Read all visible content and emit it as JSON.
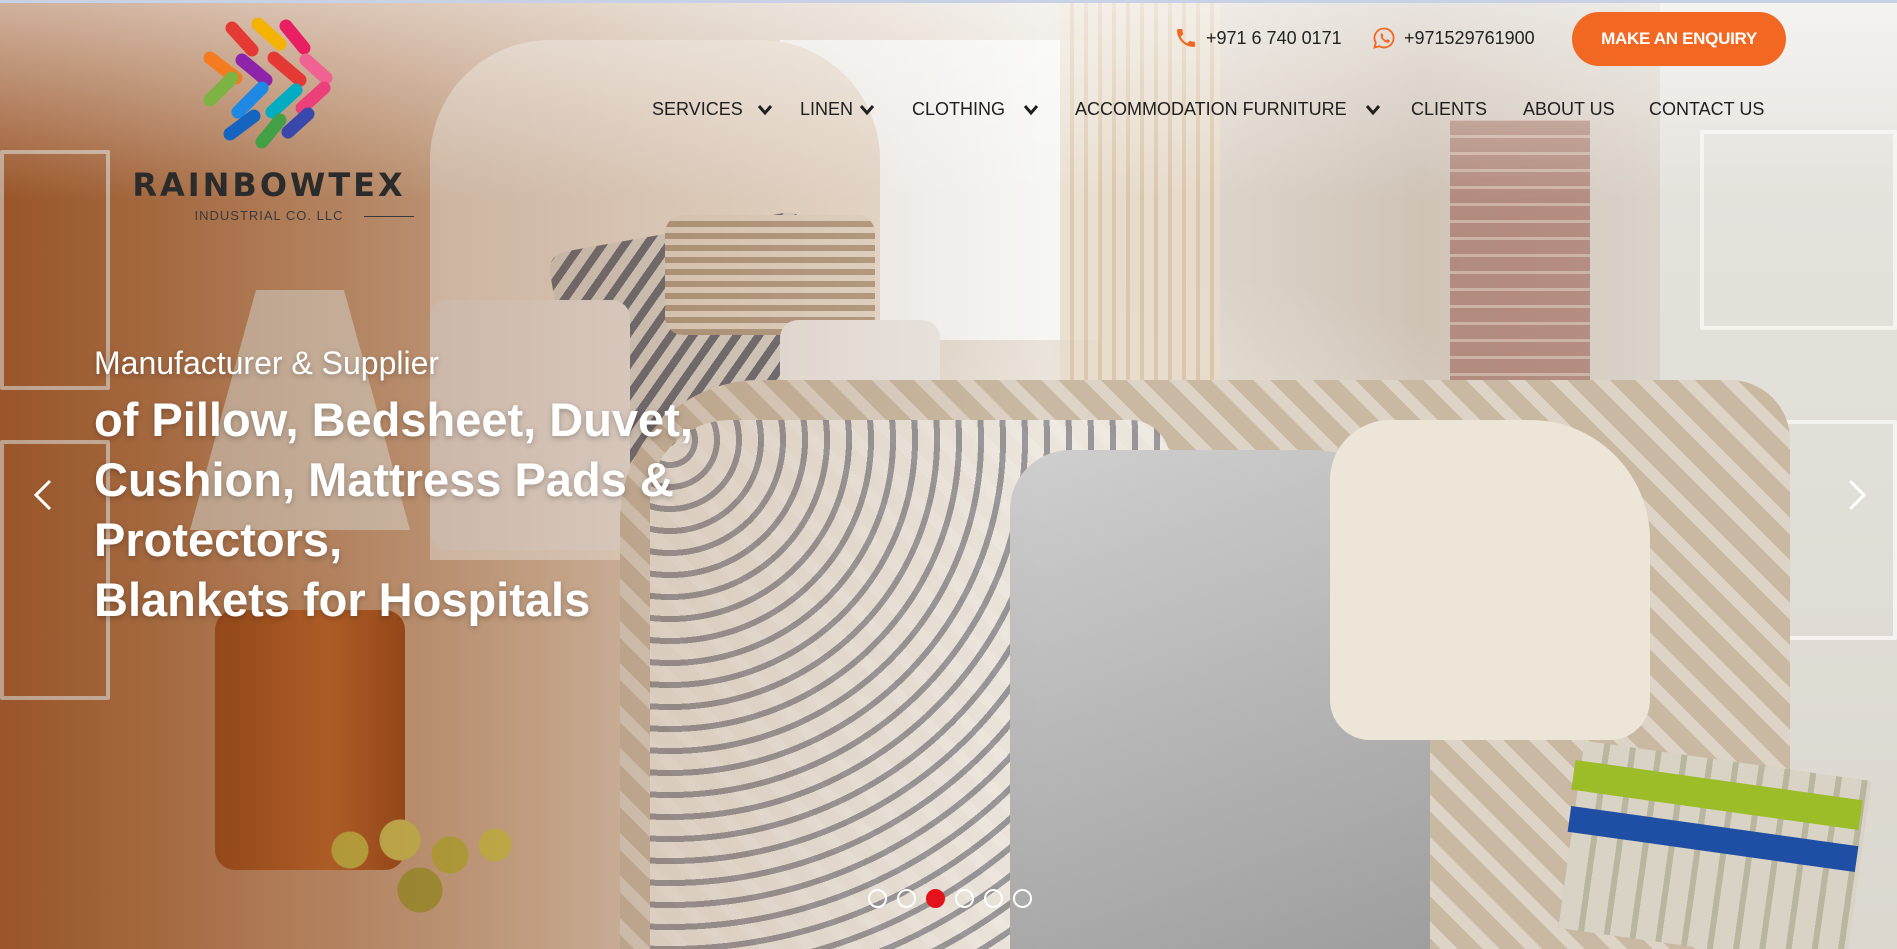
{
  "brand": {
    "name": "RAINBOWTEX",
    "tagline": "INDUSTRIAL CO. LLC"
  },
  "contact": {
    "phone": "+971 6 740 0171",
    "whatsapp": "+971529761900",
    "phone_icon": "phone-icon",
    "whatsapp_icon": "whatsapp-icon"
  },
  "enquiry_button": "MAKE AN ENQUIRY",
  "nav": {
    "services": "SERVICES",
    "linen": "LINEN",
    "clothing": "CLOTHING",
    "accommodation": "ACCOMMODATION FURNITURE",
    "clients": "CLIENTS",
    "about": "ABOUT US",
    "contact": "CONTACT US"
  },
  "hero": {
    "subtitle": "Manufacturer & Supplier",
    "title_lines": [
      "of Pillow, Bedsheet, Duvet,",
      "Cushion, Mattress Pads &",
      "Protectors,",
      "Blankets for Hospitals"
    ]
  },
  "slider": {
    "slide_count": 6,
    "active_index": 2
  },
  "colors": {
    "accent": "#f26722",
    "dot_active": "#e3121b",
    "nav_text": "#1f1f1f"
  }
}
